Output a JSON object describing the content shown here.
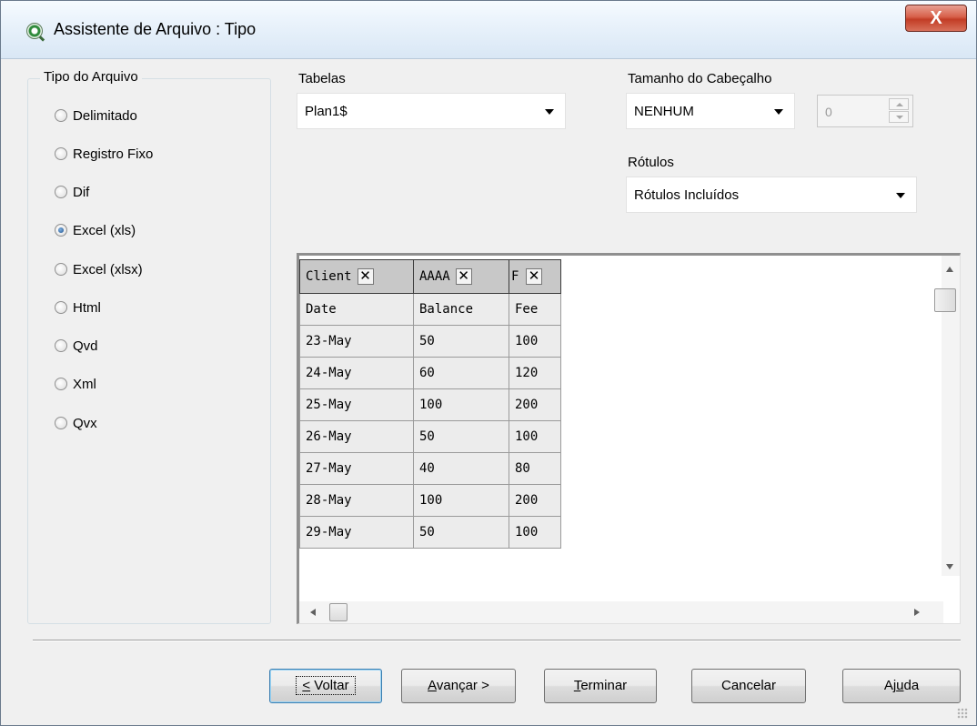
{
  "window": {
    "title": "Assistente de Arquivo : Tipo",
    "close_label": "X"
  },
  "file_type": {
    "legend": "Tipo do Arquivo",
    "options": [
      {
        "label": "Delimitado",
        "checked": false
      },
      {
        "label": "Registro Fixo",
        "checked": false
      },
      {
        "label": "Dif",
        "checked": false
      },
      {
        "label": "Excel (xls)",
        "checked": true
      },
      {
        "label": "Excel (xlsx)",
        "checked": false
      },
      {
        "label": "Html",
        "checked": false
      },
      {
        "label": "Qvd",
        "checked": false
      },
      {
        "label": "Xml",
        "checked": false
      },
      {
        "label": "Qvx",
        "checked": false
      }
    ]
  },
  "tables": {
    "label": "Tabelas",
    "value": "Plan1$"
  },
  "header_size": {
    "label": "Tamanho do Cabeçalho",
    "value": "NENHUM",
    "count": "0"
  },
  "labels": {
    "label": "Rótulos",
    "value": "Rótulos Incluídos"
  },
  "preview": {
    "headers": [
      "Client",
      "AAAA",
      "F"
    ],
    "remove_glyph": "✕",
    "rows": [
      [
        "Date",
        "Balance",
        "Fee"
      ],
      [
        "23-May",
        "50",
        "100"
      ],
      [
        "24-May",
        "60",
        "120"
      ],
      [
        "25-May",
        "100",
        "200"
      ],
      [
        "26-May",
        "50",
        "100"
      ],
      [
        "27-May",
        "40",
        "80"
      ],
      [
        "28-May",
        "100",
        "200"
      ],
      [
        "29-May",
        "50",
        "100"
      ]
    ]
  },
  "buttons": {
    "back_u": "<",
    "back_rest": " Voltar",
    "next_u": "A",
    "next_rest": "vançar >",
    "finish_u": "T",
    "finish_rest": "erminar",
    "cancel": "Cancelar",
    "help_pre": "Aj",
    "help_u": "u",
    "help_post": "da"
  }
}
